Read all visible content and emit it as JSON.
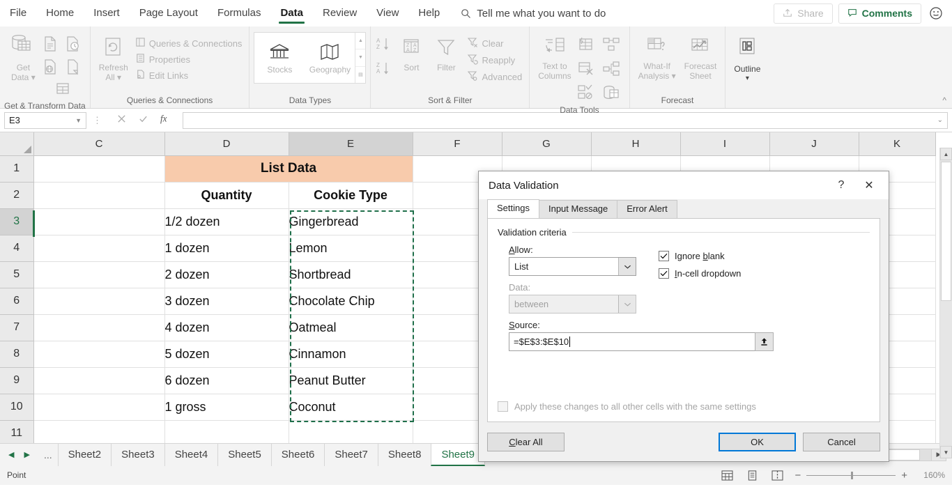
{
  "ribbon": {
    "tabs": [
      {
        "label": "File",
        "active": false
      },
      {
        "label": "Home",
        "active": false
      },
      {
        "label": "Insert",
        "active": false
      },
      {
        "label": "Page Layout",
        "active": false
      },
      {
        "label": "Formulas",
        "active": false
      },
      {
        "label": "Data",
        "active": true
      },
      {
        "label": "Review",
        "active": false
      },
      {
        "label": "View",
        "active": false
      },
      {
        "label": "Help",
        "active": false
      }
    ],
    "tellme_placeholder": "Tell me what you want to do",
    "share_label": "Share",
    "comments_label": "Comments",
    "accent_green": "#217346",
    "groups": {
      "get_transform": {
        "title": "Get & Transform Data",
        "get_data_line1": "Get",
        "get_data_line2": "Data"
      },
      "queries": {
        "title": "Queries & Connections",
        "refresh_line1": "Refresh",
        "refresh_line2": "All",
        "items": [
          "Queries & Connections",
          "Properties",
          "Edit Links"
        ]
      },
      "data_types": {
        "title": "Data Types",
        "items": [
          "Stocks",
          "Geography"
        ]
      },
      "sort_filter": {
        "title": "Sort & Filter",
        "sort_label": "Sort",
        "filter_label": "Filter",
        "items": [
          "Clear",
          "Reapply",
          "Advanced"
        ]
      },
      "data_tools": {
        "title": "Data Tools",
        "text_to_columns_line1": "Text to",
        "text_to_columns_line2": "Columns"
      },
      "forecast": {
        "title": "Forecast",
        "whatif_line1": "What-If",
        "whatif_line2": "Analysis",
        "forecast_line1": "Forecast",
        "forecast_line2": "Sheet"
      },
      "outline": {
        "title": "",
        "label": "Outline"
      }
    }
  },
  "formula_bar": {
    "name_box": "E3",
    "formula": ""
  },
  "grid": {
    "columns": [
      "C",
      "D",
      "E",
      "F",
      "G",
      "H",
      "I",
      "J",
      "K"
    ],
    "selected_column": "E",
    "rows": [
      {
        "num": "1",
        "C": "",
        "D": "List Data",
        "E": "",
        "F": "",
        "G": "",
        "H": "",
        "I": "",
        "J": "",
        "K": ""
      },
      {
        "num": "2",
        "C": "",
        "D": "Quantity",
        "E": "Cookie Type",
        "F": "",
        "G": "",
        "H": "",
        "I": "",
        "J": "",
        "K": ""
      },
      {
        "num": "3",
        "C": "",
        "D": "1/2 dozen",
        "E": "Gingerbread",
        "F": "",
        "G": "",
        "H": "",
        "I": "",
        "J": "",
        "K": ""
      },
      {
        "num": "4",
        "C": "",
        "D": "1 dozen",
        "E": "Lemon",
        "F": "",
        "G": "",
        "H": "",
        "I": "",
        "J": "",
        "K": ""
      },
      {
        "num": "5",
        "C": "",
        "D": "2 dozen",
        "E": "Shortbread",
        "F": "",
        "G": "",
        "H": "",
        "I": "",
        "J": "",
        "K": ""
      },
      {
        "num": "6",
        "C": "",
        "D": "3 dozen",
        "E": "Chocolate Chip",
        "F": "",
        "G": "",
        "H": "",
        "I": "",
        "J": "",
        "K": ""
      },
      {
        "num": "7",
        "C": "",
        "D": "4 dozen",
        "E": "Oatmeal",
        "F": "",
        "G": "",
        "H": "",
        "I": "",
        "J": "",
        "K": ""
      },
      {
        "num": "8",
        "C": "",
        "D": "5 dozen",
        "E": "Cinnamon",
        "F": "",
        "G": "",
        "H": "",
        "I": "",
        "J": "",
        "K": ""
      },
      {
        "num": "9",
        "C": "",
        "D": "6 dozen",
        "E": "Peanut Butter",
        "F": "",
        "G": "",
        "H": "",
        "I": "",
        "J": "",
        "K": ""
      },
      {
        "num": "10",
        "C": "",
        "D": "1 gross",
        "E": "Coconut",
        "F": "",
        "G": "",
        "H": "",
        "I": "",
        "J": "",
        "K": ""
      },
      {
        "num": "11",
        "C": "",
        "D": "",
        "E": "",
        "F": "",
        "G": "",
        "H": "",
        "I": "",
        "J": "",
        "K": ""
      }
    ],
    "selected_row": "3",
    "header_fill": "#f8cbac",
    "marching_ants_color": "#1f6f4a"
  },
  "dialog": {
    "title": "Data Validation",
    "help_glyph": "?",
    "close_glyph": "✕",
    "tabs": [
      {
        "label": "Settings",
        "active": true
      },
      {
        "label": "Input Message",
        "active": false
      },
      {
        "label": "Error Alert",
        "active": false
      }
    ],
    "legend": "Validation criteria",
    "allow_label": "Allow:",
    "allow_value": "List",
    "data_label": "Data:",
    "data_value": "between",
    "source_label": "Source:",
    "source_value": "=$E$3:$E$10",
    "ignore_blank_label": "Ignore blank",
    "ignore_blank_checked": true,
    "incell_dropdown_label": "In-cell dropdown",
    "incell_dropdown_checked": true,
    "apply_all_label": "Apply these changes to all other cells with the same settings",
    "apply_all_checked": false,
    "clear_all_label": "Clear All",
    "ok_label": "OK",
    "cancel_label": "Cancel"
  },
  "sheet_tabs": {
    "left_ellipsis": "...",
    "right_ellipsis": "...",
    "items": [
      {
        "label": "Sheet2",
        "active": false
      },
      {
        "label": "Sheet3",
        "active": false
      },
      {
        "label": "Sheet4",
        "active": false
      },
      {
        "label": "Sheet5",
        "active": false
      },
      {
        "label": "Sheet6",
        "active": false
      },
      {
        "label": "Sheet7",
        "active": false
      },
      {
        "label": "Sheet8",
        "active": false
      },
      {
        "label": "Sheet9",
        "active": true
      }
    ]
  },
  "status_bar": {
    "mode": "Point",
    "zoom": "160%"
  }
}
